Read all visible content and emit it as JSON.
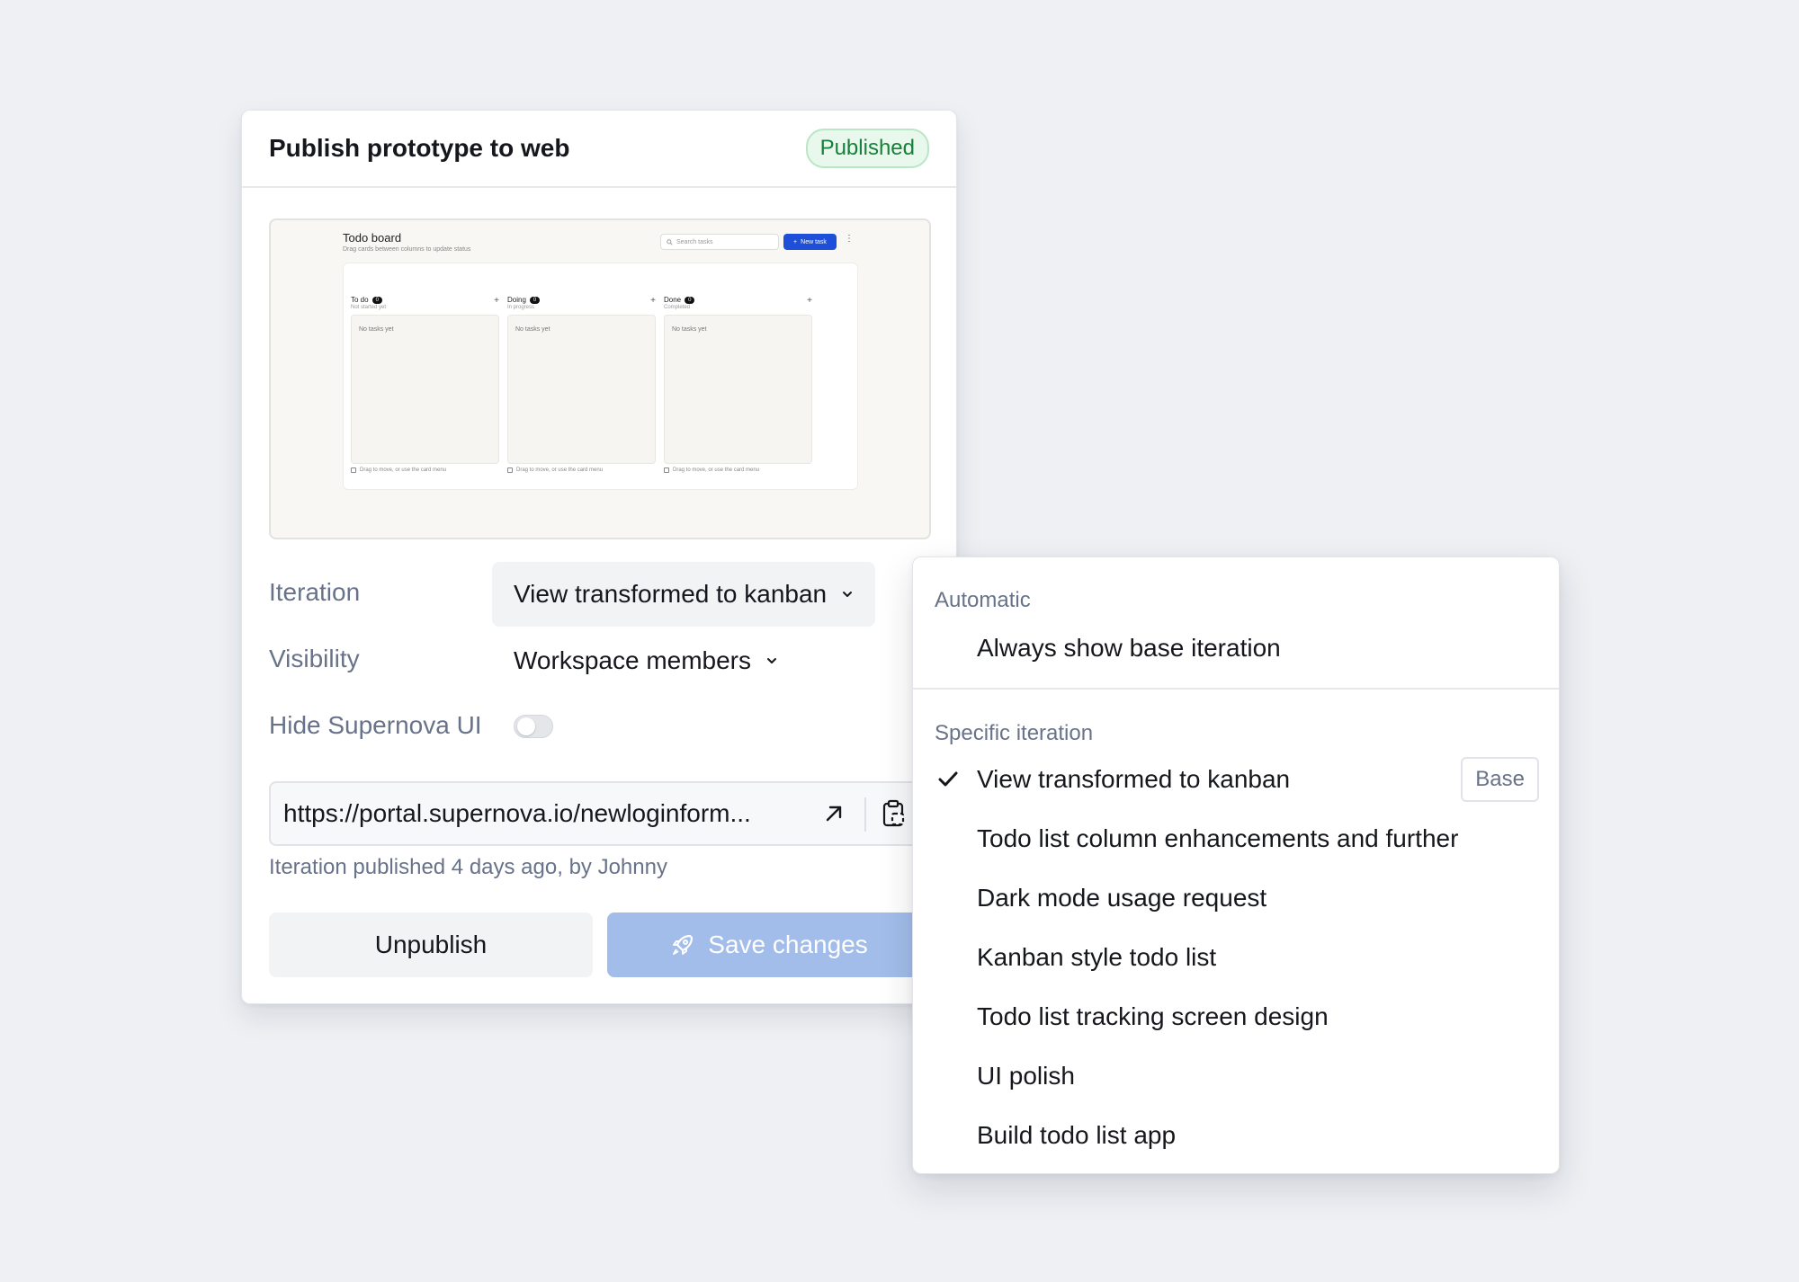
{
  "panel": {
    "title": "Publish prototype to web",
    "status": "Published"
  },
  "preview": {
    "title": "Todo board",
    "subtitle": "Drag cards between columns to update status",
    "search_placeholder": "Search tasks",
    "new_task_label": "New task",
    "columns": [
      {
        "name": "To do",
        "count": "0",
        "subtitle": "Not started yet",
        "empty": "No tasks yet",
        "hint": "Drag to move, or use the card menu"
      },
      {
        "name": "Doing",
        "count": "0",
        "subtitle": "In progress",
        "empty": "No tasks yet",
        "hint": "Drag to move, or use the card menu"
      },
      {
        "name": "Done",
        "count": "0",
        "subtitle": "Completed",
        "empty": "No tasks yet",
        "hint": "Drag to move, or use the card menu"
      }
    ]
  },
  "form": {
    "iteration_label": "Iteration",
    "iteration_value": "View transformed to kanban",
    "visibility_label": "Visibility",
    "visibility_value": "Workspace members",
    "hide_ui_label": "Hide Supernova UI",
    "hide_ui_enabled": false,
    "url": "https://portal.supernova.io/newloginform...",
    "published_meta": "Iteration published 4 days ago, by Johnny"
  },
  "actions": {
    "unpublish_label": "Unpublish",
    "save_label": "Save changes"
  },
  "dropdown": {
    "automatic_heading": "Automatic",
    "automatic_option": "Always show base iteration",
    "specific_heading": "Specific iteration",
    "base_tag": "Base",
    "options": [
      {
        "label": "View transformed to kanban",
        "selected": true
      },
      {
        "label": "Todo list column enhancements and further",
        "selected": false
      },
      {
        "label": "Dark mode usage request",
        "selected": false
      },
      {
        "label": "Kanban style todo list",
        "selected": false
      },
      {
        "label": "Todo list tracking screen design",
        "selected": false
      },
      {
        "label": "UI polish",
        "selected": false
      },
      {
        "label": "Build todo list app",
        "selected": false
      }
    ]
  },
  "colors": {
    "background": "#eef0f4",
    "success": "#17803a",
    "primary_disabled": "#a2bdea",
    "muted_text": "#68738a"
  }
}
